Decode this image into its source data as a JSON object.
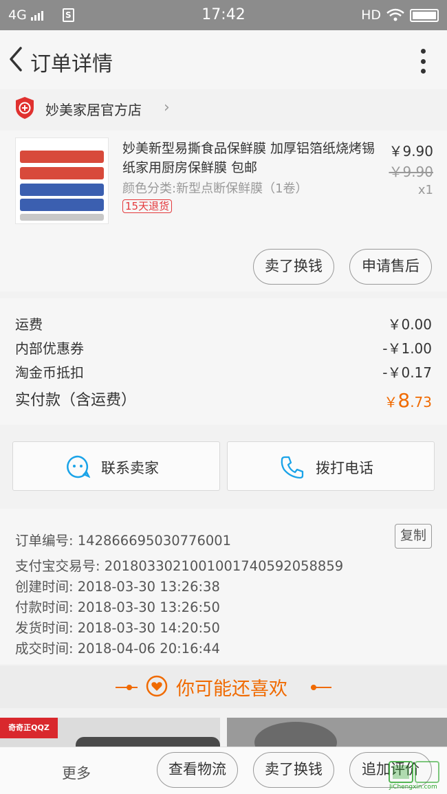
{
  "status_bar": {
    "network": "4G",
    "time": "17:42",
    "hd": "HD"
  },
  "nav": {
    "title": "订单详情"
  },
  "shop": {
    "name": "妙美家居官方店"
  },
  "product": {
    "title": "妙美新型易撕食品保鲜膜 加厚铝箔纸烧烤锡纸家用厨房保鲜膜 包邮",
    "attributes": "颜色分类:新型点断保鲜膜（1卷）",
    "tag": "15天退货",
    "price": "￥9.90",
    "original_price": "￥9.90",
    "quantity": "x1",
    "actions": [
      "卖了换钱",
      "申请售后"
    ]
  },
  "fees": {
    "rows": [
      {
        "label": "运费",
        "value": "￥0.00"
      },
      {
        "label": "内部优惠券",
        "value": "-￥1.00"
      },
      {
        "label": "淘金币抵扣",
        "value": "-￥0.17"
      }
    ],
    "total_label": "实付款（含运费）",
    "total_currency": "￥",
    "total_int": "8",
    "total_dec": ".73"
  },
  "contacts": {
    "seller": "联系卖家",
    "call": "拨打电话"
  },
  "order_info": {
    "copy_label": "复制",
    "rows": [
      "订单编号: 142866695030776001",
      "支付宝交易号: 2018033021001001740592058859",
      "创建时间: 2018-03-30 13:26:38",
      "付款时间: 2018-03-30 13:26:50",
      "发货时间: 2018-03-30 14:20:50",
      "成交时间: 2018-04-06 20:16:44"
    ]
  },
  "guess": {
    "title": "你可能还喜欢"
  },
  "recommend": {
    "badge": "奇奇正QQZ"
  },
  "bottom_bar": {
    "more": "更多",
    "buttons": [
      "查看物流",
      "卖了换钱",
      "追加评价"
    ]
  },
  "watermark": {
    "text": "JiChengxin.com"
  },
  "colors": {
    "accent": "#f06a00",
    "tag_red": "#e4393c",
    "icon_blue": "#1aa3e8"
  }
}
